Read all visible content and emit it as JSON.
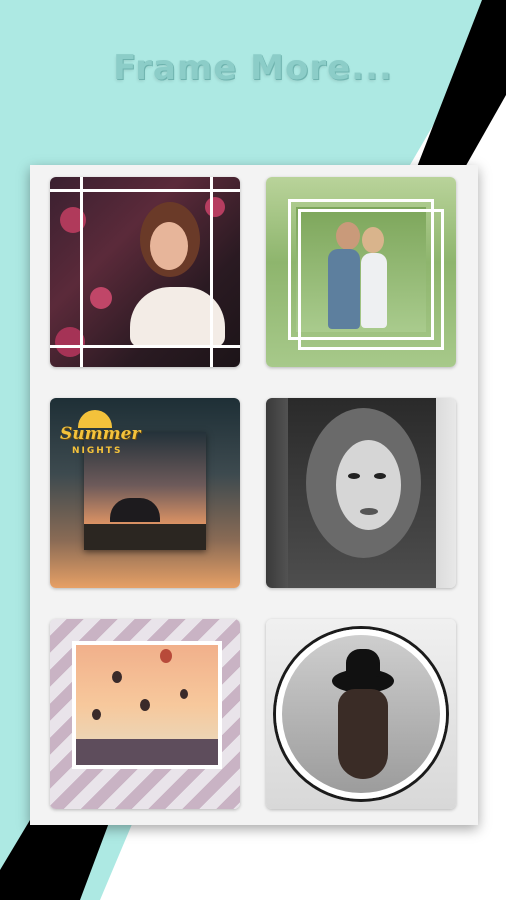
{
  "headline": "Frame More...",
  "colors": {
    "mint_background": "#ade9e3",
    "stripe": "#000000",
    "panel": "#f3f3f3",
    "headline_text": "#8ccdc8"
  },
  "frames": [
    {
      "name": "woman-roses-grid-frame",
      "style": "white-grid-lines"
    },
    {
      "name": "couple-square-frame",
      "style": "offset-white-square"
    },
    {
      "name": "sunset-couple-frame",
      "style": "inset-photo",
      "overlay_text": [
        "Summer",
        "NIGHTS"
      ]
    },
    {
      "name": "hooded-woman-frame",
      "style": "black-and-white-panel"
    },
    {
      "name": "hot-air-balloon-frame",
      "style": "diagonal-stripes"
    },
    {
      "name": "woman-hat-circle-frame",
      "style": "circle-ring"
    }
  ]
}
